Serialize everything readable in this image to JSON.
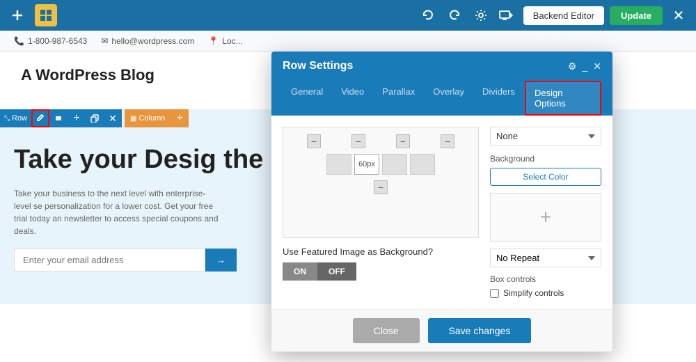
{
  "toolbar": {
    "phone": "1-800-987-6543",
    "email": "hello@wordpress.com",
    "backend_editor_label": "Backend Editor",
    "update_label": "Update"
  },
  "site": {
    "title": "A WordPress Blog",
    "hero_heading": "Take your Desig the Next Level",
    "hero_subtext": "Take your business to the next level with enterprise-level se personalization for a lower cost. Get your free trial today an newsletter to access special coupons and deals.",
    "email_placeholder": "Enter your email address"
  },
  "row_editor": {
    "row_label": "Row",
    "column_label": "Column"
  },
  "modal": {
    "title": "Row Settings",
    "tabs": [
      "General",
      "Video",
      "Parallax",
      "Overlay",
      "Dividers",
      "Design Options"
    ],
    "active_tab": "Design Options",
    "grid_value": "60px",
    "featured_image_label": "Use Featured Image as Background?",
    "toggle_on": "ON",
    "toggle_off": "OFF",
    "none_option": "None",
    "background_label": "Background",
    "select_color_label": "Select Color",
    "no_repeat_option": "No Repeat",
    "box_controls_label": "Box controls",
    "simplify_controls_label": "Simplify controls",
    "close_label": "Close",
    "save_label": "Save changes"
  }
}
